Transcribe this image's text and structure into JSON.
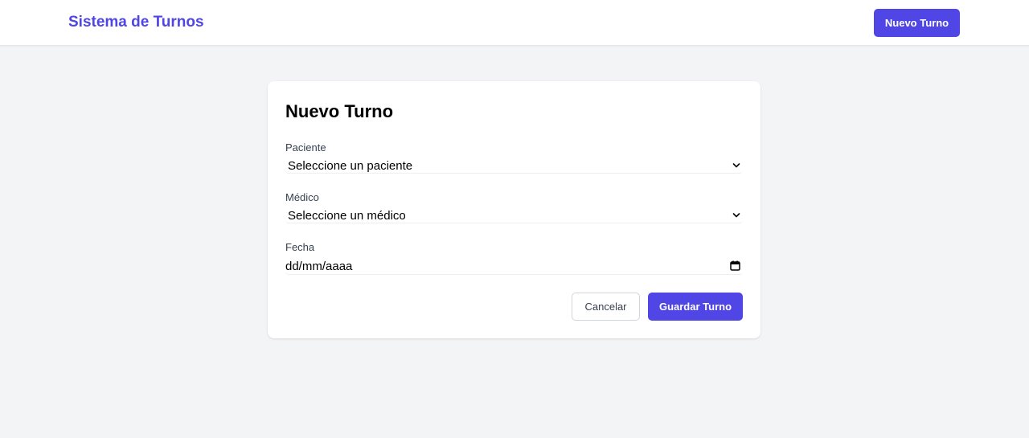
{
  "navbar": {
    "brand": "Sistema de Turnos",
    "new_button_label": "Nuevo Turno"
  },
  "form": {
    "title": "Nuevo Turno",
    "fields": [
      {
        "label": "Paciente",
        "value": "Seleccione un paciente",
        "icon": "chevron-down-icon"
      },
      {
        "label": "Médico",
        "value": "Seleccione un médico",
        "icon": "chevron-down-icon"
      },
      {
        "label": "Fecha",
        "value": "dd/mm/aaaa",
        "icon": "calendar-icon"
      }
    ],
    "cancel_label": "Cancelar",
    "save_label": "Guardar Turno"
  },
  "colors": {
    "accent": "#4f46e5",
    "background": "#f3f4f6",
    "card": "#ffffff"
  }
}
